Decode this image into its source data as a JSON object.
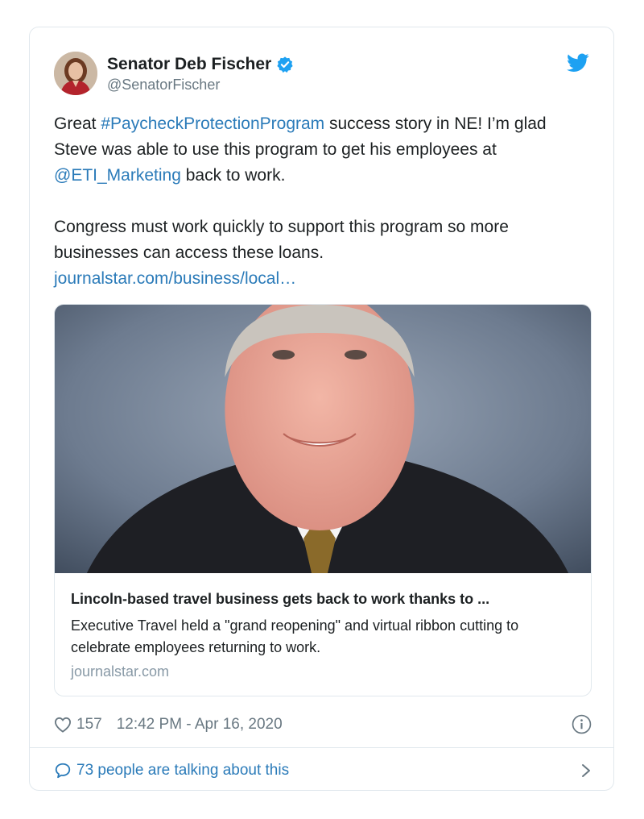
{
  "author": {
    "display_name": "Senator Deb Fischer",
    "handle": "@SenatorFischer",
    "verified_icon": "verified-badge-icon",
    "avatar_icon": "avatar"
  },
  "brand": {
    "icon": "twitter-bird-icon",
    "color": "#1da1f2"
  },
  "tweet": {
    "p1_pre": "Great ",
    "hashtag": "#PaycheckProtectionProgram",
    "p1_mid": " success story in NE! I’m glad Steve was able to use this program to get his employees at ",
    "mention": "@ETI_Marketing",
    "p1_post": " back to work.",
    "p2": "Congress must work quickly to support this program so more businesses can access these loans.",
    "url": "journalstar.com/business/local…"
  },
  "link_card": {
    "title": "Lincoln-based travel business gets back to work thanks to ...",
    "description": "Executive Travel held a \"grand reopening\" and virtual ribbon cutting to celebrate employees returning to work.",
    "domain": "journalstar.com"
  },
  "meta": {
    "like_count": "157",
    "timestamp": "12:42 PM - Apr 16, 2020"
  },
  "footer": {
    "talking_text": "73 people are talking about this"
  },
  "colors": {
    "link": "#2b7bb9",
    "muted": "#697882",
    "border": "#e1e8ed"
  }
}
